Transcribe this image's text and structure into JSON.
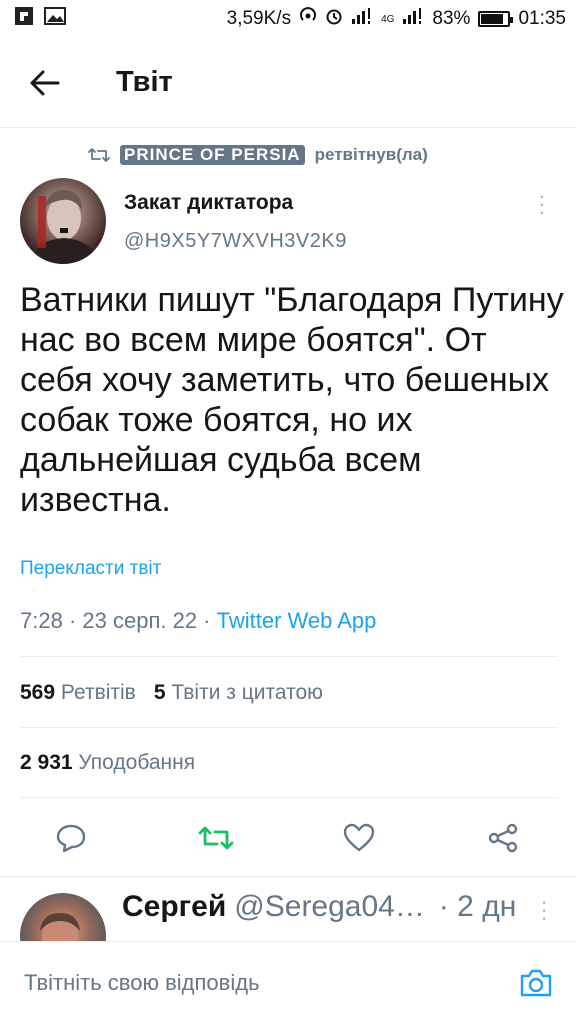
{
  "status_bar": {
    "left_icons": [
      "flipboard-icon",
      "image-icon"
    ],
    "speed": "3,59K/s",
    "network": "4G",
    "battery": "83%",
    "battery_level": 0.83,
    "time": "01:35"
  },
  "header": {
    "title": "Твіт"
  },
  "retweet": {
    "by": "PRINCE OF PERSIA",
    "suffix": "ретвітнув(ла)"
  },
  "tweet": {
    "author_name": "Закат диктатора",
    "author_handle": "@H9X5Y7WXVH3V2K9",
    "text": "Ватники пишут \"Благодаря Путину нас во всем мире боятся\". От себя хочу заметить, что бешеных собак тоже боятся, но их дальнейшая судьба всем известна.",
    "translate_label": "Перекласти твіт",
    "time": "7:28",
    "date": "23 серп. 22",
    "app": "Twitter Web App",
    "retweets_count": "569",
    "retweets_label": "Ретвітів",
    "quotes_count": "5",
    "quotes_label": "Твіти з цитатою",
    "likes_count": "2 931",
    "likes_label": "Уподобання"
  },
  "actions": [
    "reply-icon",
    "retweet-icon",
    "like-icon",
    "share-icon"
  ],
  "colors": {
    "accent": "#1da1f2",
    "retweet": "#17bf63",
    "muted": "#657786"
  },
  "reply": {
    "name": "Сергей",
    "handle": "@Serega04…",
    "time": "· 2 дн"
  },
  "compose": {
    "placeholder": "Твітніть свою відповідь"
  }
}
